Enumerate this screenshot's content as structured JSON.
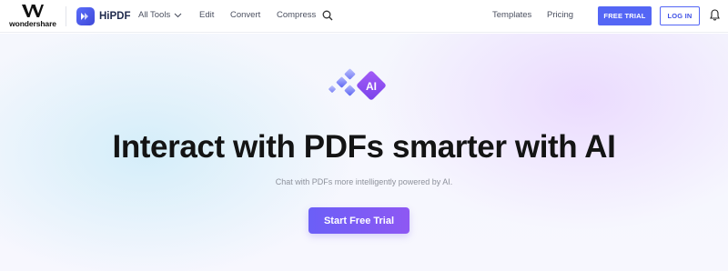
{
  "header": {
    "brand_name": "wondershare",
    "product_name": "HiPDF",
    "nav": {
      "all_tools": "All Tools",
      "edit": "Edit",
      "convert": "Convert",
      "compress": "Compress",
      "templates": "Templates",
      "pricing": "Pricing"
    },
    "free_trial_label": "FREE TRIAL",
    "login_label": "LOG IN",
    "icons": {
      "dropdown": "chevron-down-icon",
      "search": "search-icon",
      "notifications": "bell-icon"
    }
  },
  "hero": {
    "logo_text": "AI",
    "headline": "Interact with PDFs smarter with AI",
    "subheadline": "Chat with PDFs more intelligently powered by AI.",
    "cta_label": "Start Free Trial"
  },
  "colors": {
    "accent": "#5466f5",
    "cta_gradient_start": "#6b5ff7",
    "cta_gradient_end": "#8e58f3",
    "ai_badge": "#8b4cf0"
  }
}
